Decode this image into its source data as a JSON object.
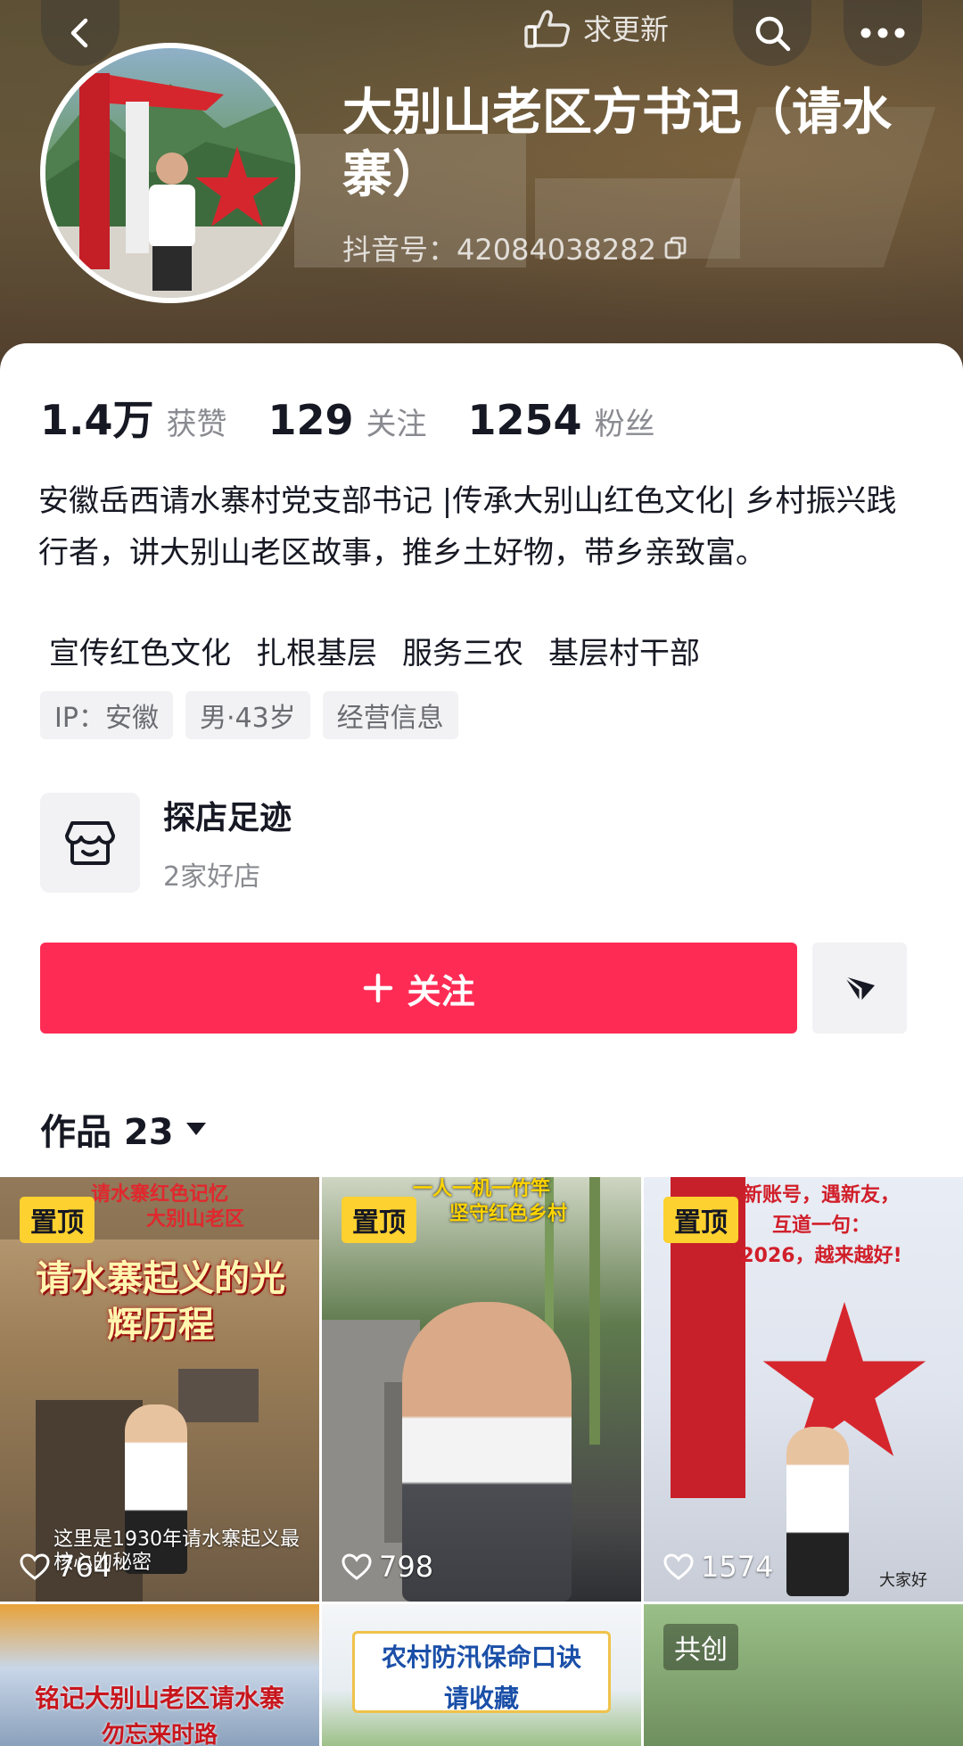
{
  "header": {
    "update_label": "求更新",
    "profile_name": "大别山老区方书记（请水寨）",
    "douyin_id": "抖音号：42084038282"
  },
  "stats": [
    {
      "value": "1.4万",
      "label": "获赞"
    },
    {
      "value": "129",
      "label": "关注"
    },
    {
      "value": "1254",
      "label": "粉丝"
    }
  ],
  "bio": {
    "text": "安徽岳西请水寨村党支部书记 |传承大别山红色文化| 乡村振兴践行者，讲大别山老区故事，推乡土好物，带乡亲致富。",
    "tags": [
      "宣传红色文化",
      "扎根基层",
      "服务三农",
      "基层村干部"
    ]
  },
  "chips": [
    "IP：安徽",
    "男·43岁",
    "经营信息"
  ],
  "shop": {
    "title": "探店足迹",
    "subtitle": "2家好店"
  },
  "actions": {
    "follow_label": "关注"
  },
  "works": {
    "label": "作品 23"
  },
  "grid": [
    {
      "badge": "置顶",
      "top_text_1": "请水寨红色记忆",
      "top_text_2": "大别山老区",
      "title": "请水寨起义的光辉历程",
      "likes": "764",
      "caption": "这里是1930年请水寨起义最核心的秘密"
    },
    {
      "badge": "置顶",
      "top_text_1": "一人一机一竹竿",
      "top_text_2": "坚守红色乡村",
      "likes": "798"
    },
    {
      "badge": "置顶",
      "top_text_1": "新账号，遇新友，",
      "top_text_2": "互道一句：",
      "top_text_3": "2026，越来越好!",
      "likes": "1574",
      "caption": "大家好"
    },
    {
      "title": "铭记大别山老区请水寨",
      "subtitle": "勿忘来时路"
    },
    {
      "title": "农村防汛保命口诀",
      "subtitle": "请收藏"
    },
    {
      "badge": "共创"
    }
  ],
  "colors": {
    "accent": "#fe2c55",
    "pin_badge": "#fdd12f",
    "text_primary": "#161823",
    "text_secondary": "#8a8b91"
  }
}
